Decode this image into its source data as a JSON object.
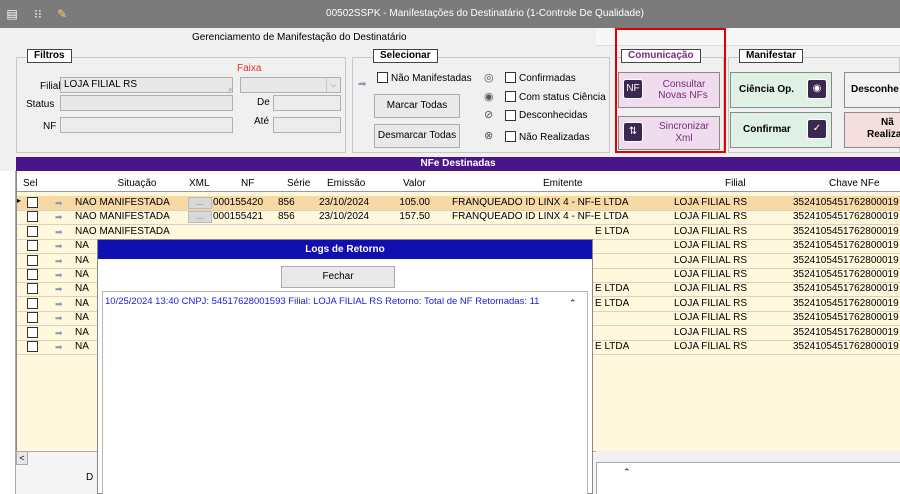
{
  "window": {
    "title": "00502SSPK - Manifestações do Destinatário (1-Controle De Qualidade)",
    "subtitle": "Gerenciamento de Manifestação do Destinatário"
  },
  "filtros": {
    "legend": "Filtros",
    "faixa_label": "Faixa",
    "filial_label": "Filial",
    "filial_value": "LOJA FILIAL RS",
    "status_label": "Status",
    "status_value": "",
    "nf_label": "NF",
    "nf_value": "",
    "de_label": "De",
    "ate_label": "Até"
  },
  "selecionar": {
    "legend": "Selecionar",
    "options": [
      "Não Manifestadas",
      "Confirmadas",
      "Com status Ciência",
      "Desconhecidas",
      "Não Realizadas"
    ],
    "marcar_todas": "Marcar Todas",
    "desmarcar_todas": "Desmarcar Todas"
  },
  "comunicacao": {
    "legend": "Comunicação",
    "consultar_line1": "Consultar",
    "consultar_line2": "Novas NFs",
    "sincronizar_line1": "Sincronizar",
    "sincronizar_line2": "Xml"
  },
  "manifestar": {
    "legend": "Manifestar",
    "ciencia": "Ciência Op.",
    "desconhe": "Desconhe",
    "confirmar": "Confirmar",
    "nao_line1": "Nã",
    "nao_line2": "Realiza"
  },
  "grid": {
    "title": "NFe Destinadas",
    "columns": [
      "Sel",
      "Situação",
      "XML",
      "NF",
      "Série",
      "Emissão",
      "Valor",
      "Emitente",
      "Filial",
      "Chave NFe"
    ],
    "rows": [
      {
        "situacao": "NÃO MANIFESTADA",
        "xml": "...",
        "nf": "000155420",
        "serie": "856",
        "emissao": "23/10/2024",
        "valor": "105.00",
        "emitente": "FRANQUEADO ID LINX 4 - NF-E LTDA",
        "filial": "LOJA FILIAL RS",
        "chave": "3524105451762800019"
      },
      {
        "situacao": "NÃO MANIFESTADA",
        "xml": "...",
        "nf": "000155421",
        "serie": "856",
        "emissao": "23/10/2024",
        "valor": "157.50",
        "emitente": "FRANQUEADO ID LINX 4 - NF-E LTDA",
        "filial": "LOJA FILIAL RS",
        "chave": "3524105451762800019"
      },
      {
        "situacao": "NÃO MANIFESTADA",
        "xml": "",
        "nf": "",
        "serie": "",
        "emissao": "",
        "valor": "",
        "emitente": "E LTDA",
        "filial": "LOJA FILIAL RS",
        "chave": "3524105451762800019"
      },
      {
        "situacao": "NÃ",
        "xml": "",
        "nf": "",
        "serie": "",
        "emissao": "",
        "valor": "",
        "emitente": "",
        "filial": "LOJA FILIAL RS",
        "chave": "3524105451762800019"
      },
      {
        "situacao": "NÃ",
        "xml": "",
        "nf": "",
        "serie": "",
        "emissao": "",
        "valor": "",
        "emitente": "",
        "filial": "LOJA FILIAL RS",
        "chave": "3524105451762800019"
      },
      {
        "situacao": "NÃ",
        "xml": "",
        "nf": "",
        "serie": "",
        "emissao": "",
        "valor": "",
        "emitente": "",
        "filial": "LOJA FILIAL RS",
        "chave": "3524105451762800019"
      },
      {
        "situacao": "NÃ",
        "xml": "",
        "nf": "",
        "serie": "",
        "emissao": "",
        "valor": "",
        "emitente": "E LTDA",
        "filial": "LOJA FILIAL RS",
        "chave": "3524105451762800019"
      },
      {
        "situacao": "NÃ",
        "xml": "",
        "nf": "",
        "serie": "",
        "emissao": "",
        "valor": "",
        "emitente": "E LTDA",
        "filial": "LOJA FILIAL RS",
        "chave": "3524105451762800019"
      },
      {
        "situacao": "NÃ",
        "xml": "",
        "nf": "",
        "serie": "",
        "emissao": "",
        "valor": "",
        "emitente": "",
        "filial": "LOJA FILIAL RS",
        "chave": "3524105451762800019"
      },
      {
        "situacao": "NÃ",
        "xml": "",
        "nf": "",
        "serie": "",
        "emissao": "",
        "valor": "",
        "emitente": "",
        "filial": "LOJA FILIAL RS",
        "chave": "3524105451762800019"
      },
      {
        "situacao": "NÃ",
        "xml": "",
        "nf": "",
        "serie": "",
        "emissao": "",
        "valor": "",
        "emitente": "E LTDA",
        "filial": "LOJA FILIAL RS",
        "chave": "3524105451762800019"
      }
    ]
  },
  "modal": {
    "title": "Logs de Retorno",
    "close_label": "Fechar",
    "log_text": "10/25/2024 13:40 CNPJ: 54517628001593 Filial: LOJA FILIAL RS Retorno:  Total de NF Retornadas: 11"
  },
  "bottom": {
    "left_letter": "D"
  },
  "colors": {
    "grid_header": "#49158a",
    "modal_header": "#1010b0",
    "highlight_box": "#e00000",
    "log_text": "#1a1adb"
  }
}
